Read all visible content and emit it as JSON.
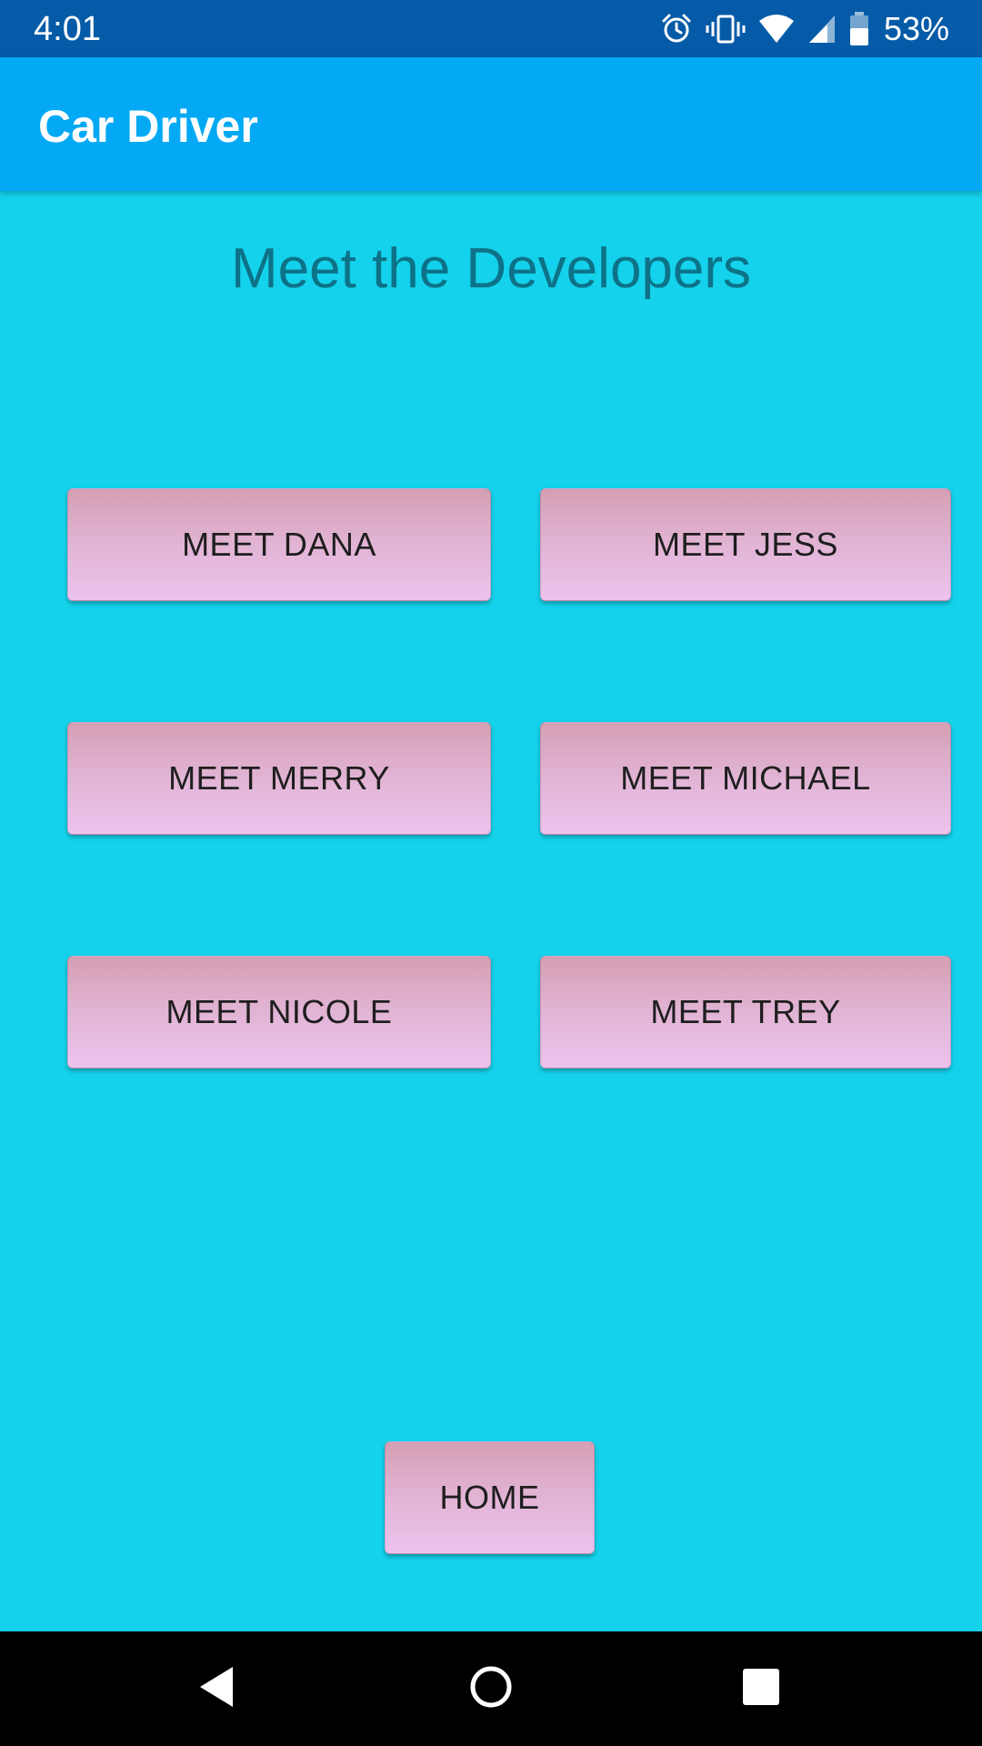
{
  "status_bar": {
    "time": "4:01",
    "icons": [
      "alarm-icon",
      "vibrate-icon",
      "wifi-icon",
      "cell-signal-icon",
      "battery-icon"
    ],
    "battery_percent": "53%"
  },
  "app_bar": {
    "title": "Car Driver",
    "color": "#03a9f4"
  },
  "main": {
    "heading": "Meet the Developers",
    "buttons": [
      {
        "label": "MEET DANA"
      },
      {
        "label": "MEET JESS"
      },
      {
        "label": "MEET MERRY"
      },
      {
        "label": "MEET MICHAEL"
      },
      {
        "label": "MEET NICOLE"
      },
      {
        "label": "MEET TREY"
      }
    ],
    "home_button": "HOME",
    "background_color": "#14d2eb"
  },
  "nav_bar": {
    "icons": [
      "back-icon",
      "home-icon",
      "recents-icon"
    ]
  }
}
